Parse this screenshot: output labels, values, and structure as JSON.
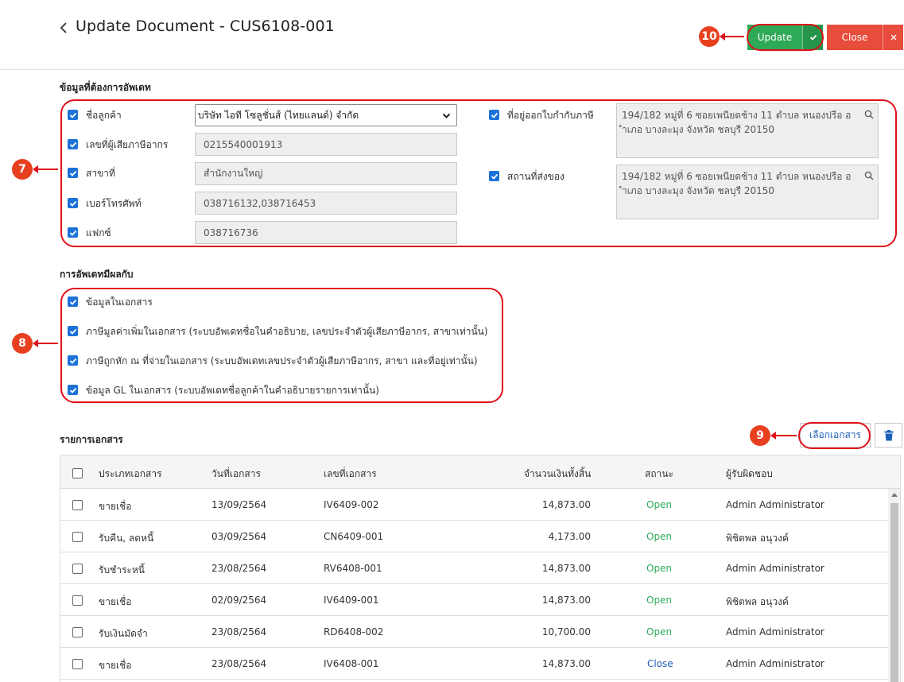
{
  "header": {
    "title": "Update Document - CUS6108-001",
    "update_label": "Update",
    "close_label": "Close"
  },
  "callouts": {
    "c7": "7",
    "c8": "8",
    "c9": "9",
    "c10": "10"
  },
  "customer_section": {
    "title": "ข้อมูลที่ต้องการอัพเดท",
    "fields": [
      {
        "label": "ชื่อลูกค้า",
        "value": "บริษัท ไอที โซลูชั่นส์ (ไทยแลนด์) จำกัด"
      },
      {
        "label": "เลขที่ผู้เสียภาษีอากร",
        "value": "0215540001913"
      },
      {
        "label": "สาขาที่",
        "value": "สำนักงานใหญ่"
      },
      {
        "label": "เบอร์โทรศัพท์",
        "value": "038716132,038716453"
      },
      {
        "label": "แฟกซ์",
        "value": "038716736"
      }
    ],
    "tax_address": {
      "label": "ที่อยู่ออกใบกำกับภาษี",
      "line1": "194/182 หมู่ที่ 6 ซอยเพนียดช้าง 11   ตำบล หนองปรือ อ",
      "line2": "ำเภอ บางละมุง จังหวัด ชลบุรี 20150"
    },
    "ship_address": {
      "label": "สถานที่ส่งของ",
      "line1": "194/182 หมู่ที่ 6 ซอยเพนียดช้าง 11   ตำบล หนองปรือ อ",
      "line2": "ำเภอ บางละมุง จังหวัด ชลบุรี 20150"
    }
  },
  "effect_section": {
    "title": "การอัพเดทมีผลกับ",
    "options": [
      "ข้อมูลในเอกสาร",
      "ภาษีมูลค่าเพิ่มในเอกสาร  (ระบบอัพเดทชื่อในคำอธิบาย, เลขประจำตัวผู้เสียภาษีอากร, สาขาเท่านั้น)",
      "ภาษีถูกหัก ณ ที่จ่ายในเอกสาร  (ระบบอัพเดทเลขประจำตัวผู้เสียภาษีอากร, สาขา และที่อยู่เท่านั้น)",
      "ข้อมูล GL ในเอกสาร  (ระบบอัพเดทชื่อลูกค้าในคำอธิบายรายการเท่านั้น)"
    ]
  },
  "documents": {
    "title": "รายการเอกสาร",
    "select_label": "เลือกเอกสาร",
    "columns": [
      "ประเภทเอกสาร",
      "วันที่เอกสาร",
      "เลขที่เอกสาร",
      "จำนวนเงินทั้งสิ้น",
      "สถานะ",
      "ผู้รับผิดชอบ"
    ],
    "rows": [
      {
        "type": "ขายเชื่อ",
        "date": "13/09/2564",
        "no": "IV6409-002",
        "amount": "14,873.00",
        "status": "Open",
        "owner": "Admin Administrator"
      },
      {
        "type": "รับคืน, ลดหนี้",
        "date": "03/09/2564",
        "no": "CN6409-001",
        "amount": "4,173.00",
        "status": "Open",
        "owner": "พิชิตพล อนุวงค์"
      },
      {
        "type": "รับชำระหนี้",
        "date": "23/08/2564",
        "no": "RV6408-001",
        "amount": "14,873.00",
        "status": "Open",
        "owner": "Admin Administrator"
      },
      {
        "type": "ขายเชื่อ",
        "date": "02/09/2564",
        "no": "IV6409-001",
        "amount": "14,873.00",
        "status": "Open",
        "owner": "พิชิตพล อนุวงค์"
      },
      {
        "type": "รับเงินมัดจำ",
        "date": "23/08/2564",
        "no": "RD6408-002",
        "amount": "10,700.00",
        "status": "Open",
        "owner": "Admin Administrator"
      },
      {
        "type": "ขายเชื่อ",
        "date": "23/08/2564",
        "no": "IV6408-001",
        "amount": "14,873.00",
        "status": "Close",
        "owner": "Admin Administrator"
      }
    ]
  },
  "colors": {
    "update_green": "#2eaa57",
    "close_red": "#e74c3c",
    "checkbox_blue": "#1d72d8",
    "annotation_red": "#e0101a",
    "callout_orange": "#e8401f"
  },
  "icons": {
    "back": "chevron-left-icon",
    "check": "check-icon",
    "close": "x-icon",
    "search": "search-icon",
    "trash": "trash-icon"
  }
}
